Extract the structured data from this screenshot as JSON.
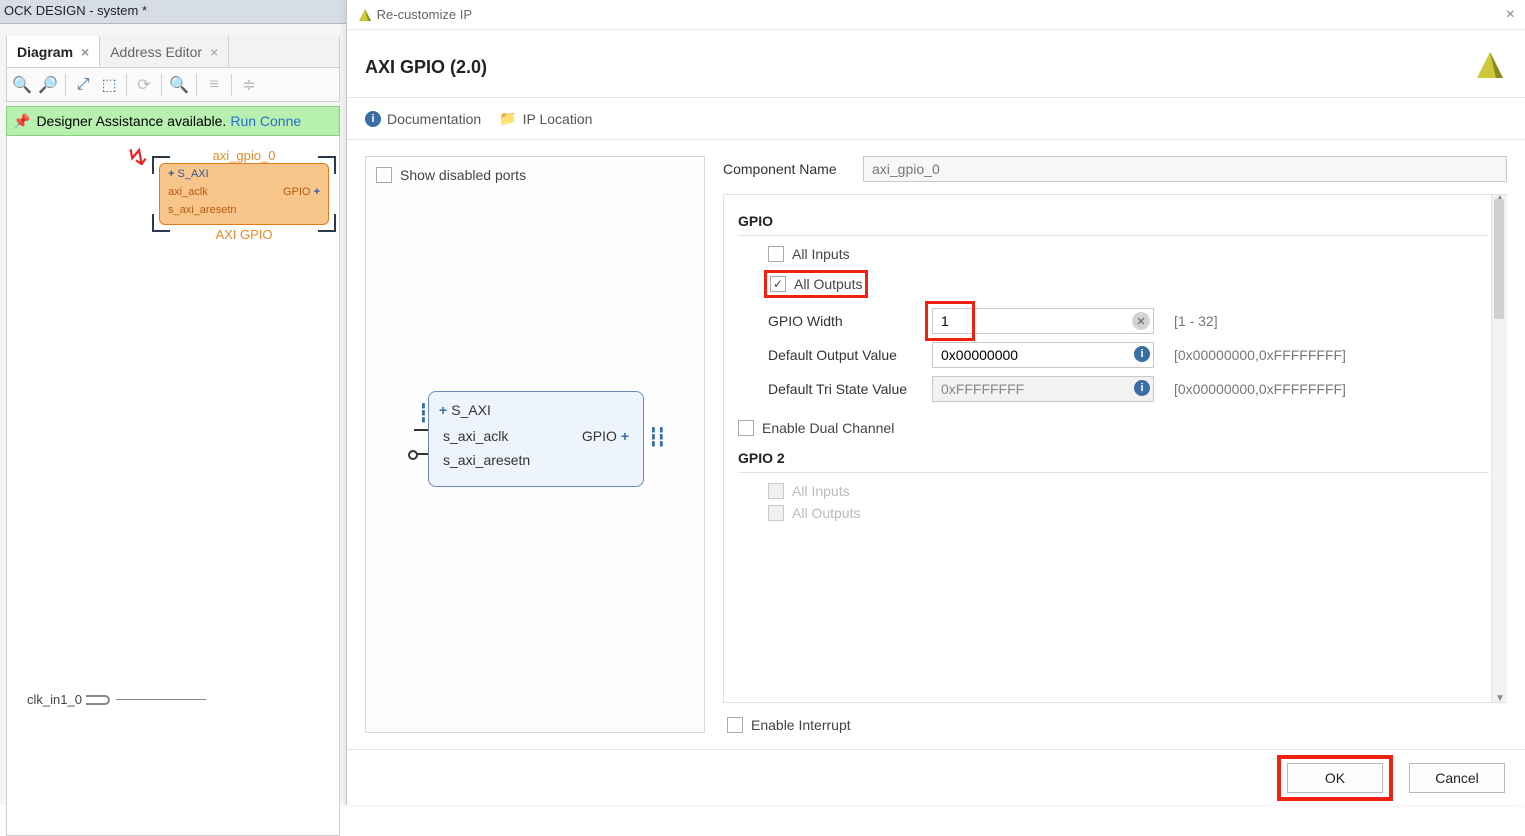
{
  "bd": {
    "window_title": "OCK DESIGN - system *",
    "tabs": [
      {
        "label": "Diagram",
        "active": true,
        "closable": true
      },
      {
        "label": "Address Editor",
        "active": false,
        "closable": true
      }
    ],
    "banner_text": "Designer Assistance available.",
    "banner_link": "Run Conne",
    "ip_block": {
      "instance": "axi_gpio_0",
      "ports_left": [
        "S_AXI",
        "axi_aclk",
        "s_axi_aresetn"
      ],
      "ports_right": [
        "GPIO"
      ],
      "footer": "AXI GPIO"
    },
    "clk_port": "clk_in1_0"
  },
  "dialog": {
    "window_title": "Re-customize IP",
    "header_title": "AXI GPIO (2.0)",
    "links": {
      "documentation": "Documentation",
      "ip_location": "IP Location"
    },
    "preview": {
      "show_disabled_ports_label": "Show disabled ports",
      "show_disabled_ports_checked": false,
      "ports_left": [
        "S_AXI",
        "s_axi_aclk",
        "s_axi_aresetn"
      ],
      "ports_right": [
        "GPIO"
      ]
    },
    "component_name_label": "Component Name",
    "component_name_value": "axi_gpio_0",
    "gpio": {
      "title": "GPIO",
      "all_inputs_label": "All Inputs",
      "all_inputs_checked": false,
      "all_outputs_label": "All Outputs",
      "all_outputs_checked": true,
      "width_label": "GPIO Width",
      "width_value": "1",
      "width_range": "[1 - 32]",
      "default_output_label": "Default Output Value",
      "default_output_value": "0x00000000",
      "default_output_range": "[0x00000000,0xFFFFFFFF]",
      "default_tri_label": "Default Tri State Value",
      "default_tri_value": "0xFFFFFFFF",
      "default_tri_range": "[0x00000000,0xFFFFFFFF]",
      "enable_dual_label": "Enable Dual Channel",
      "enable_dual_checked": false
    },
    "gpio2": {
      "title": "GPIO 2",
      "all_inputs_label": "All Inputs",
      "all_outputs_label": "All Outputs"
    },
    "enable_interrupt_label": "Enable Interrupt",
    "enable_interrupt_checked": false,
    "buttons": {
      "ok": "OK",
      "cancel": "Cancel"
    }
  }
}
